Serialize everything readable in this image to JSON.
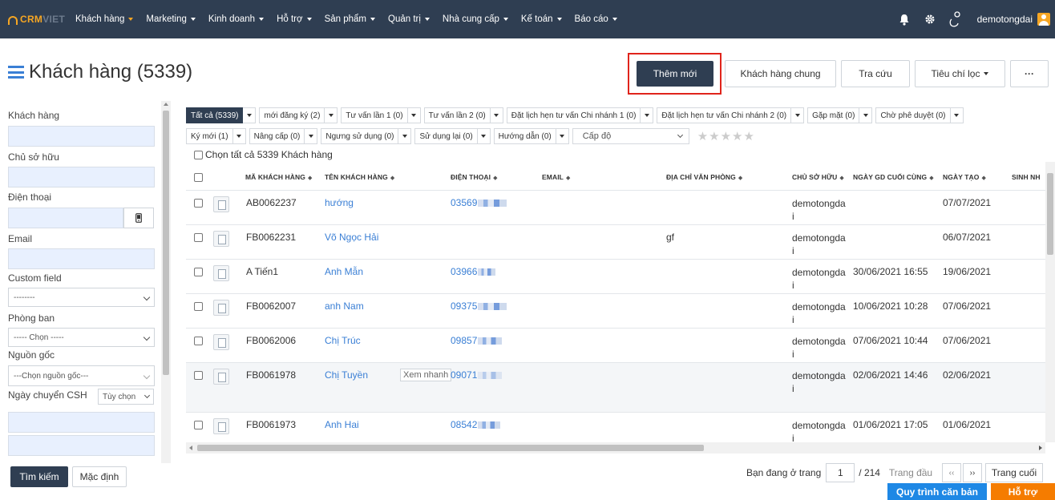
{
  "nav": {
    "logo_crm": "CRM",
    "logo_viet": "VIET",
    "menu": [
      {
        "label": "Khách hàng",
        "active": true
      },
      {
        "label": "Marketing"
      },
      {
        "label": "Kinh doanh"
      },
      {
        "label": "Hỗ trợ"
      },
      {
        "label": "Sản phẩm"
      },
      {
        "label": "Quản trị"
      },
      {
        "label": "Nhà cung cấp"
      },
      {
        "label": "Kế toán"
      },
      {
        "label": "Báo cáo"
      }
    ],
    "user_name": "demotongdai",
    "icons": [
      "bell-icon",
      "gear-icon",
      "location-pin-icon",
      "user-avatar-icon"
    ]
  },
  "header": {
    "title": "Khách hàng (5339)",
    "add_new": "Thêm mới",
    "shared_customers": "Khách hàng chung",
    "lookup": "Tra cứu",
    "filter_criteria": "Tiêu chí lọc",
    "more": "···"
  },
  "sidebar": {
    "customer_label": "Khách hàng",
    "owner_label": "Chủ sở hữu",
    "phone_label": "Điện thoại",
    "email_label": "Email",
    "custom_field_label": "Custom field",
    "custom_field_value": "--------",
    "department_label": "Phòng ban",
    "department_value": "----- Chọn -----",
    "source_label": "Nguồn gốc",
    "source_value": "---Chọn nguồn gốc---",
    "transfer_date_label": "Ngày chuyển CSH",
    "transfer_date_option": "Tùy chọn",
    "search_button": "Tìm kiếm",
    "default_button": "Mặc định"
  },
  "tags_row1": [
    {
      "label": "Tất cả (5339)",
      "active": true
    },
    {
      "label": "mới đăng ký (2)"
    },
    {
      "label": "Tư vấn lần 1 (0)"
    },
    {
      "label": "Tư vấn lần 2 (0)"
    },
    {
      "label": "Đặt lịch hẹn tư vấn Chi nhánh 1 (0)"
    },
    {
      "label": "Đặt lịch hẹn tư vấn Chi nhánh 2 (0)"
    },
    {
      "label": "Gặp mặt (0)"
    },
    {
      "label": "Chờ phê duyệt (0)"
    }
  ],
  "tags_row2": [
    {
      "label": "Ký mới (1)"
    },
    {
      "label": "Nâng cấp (0)"
    },
    {
      "label": "Ngưng sử dụng (0)"
    },
    {
      "label": "Sử dụng lại (0)"
    },
    {
      "label": "Hướng dẫn (0)"
    }
  ],
  "level_select": "Cấp độ",
  "stars": "★★★★★",
  "select_all": "Chọn tất cả 5339 Khách hàng",
  "table": {
    "columns": [
      "MÃ KHÁCH HÀNG",
      "TÊN KHÁCH HÀNG",
      "ĐIỆN THOẠI",
      "EMAIL",
      "ĐỊA CHỈ VĂN PHÒNG",
      "CHỦ SỞ HỮU",
      "NGÀY GD CUỐI CÙNG",
      "NGÀY TẠO",
      "SINH NH"
    ],
    "rows": [
      {
        "code": "AB0062237",
        "name": "hướng",
        "phone": "03569",
        "email": "",
        "address": "",
        "owner": "demotongda",
        "owner2": "i",
        "last_tx": "",
        "created": "07/07/2021"
      },
      {
        "code": "FB0062231",
        "name": "Võ Ngọc Hải",
        "phone": "",
        "email": "",
        "address": "gf",
        "owner": "demotongda",
        "owner2": "i",
        "last_tx": "",
        "created": "06/07/2021"
      },
      {
        "code": "A Tiến1",
        "name": "Anh Mẫn",
        "phone": "03966",
        "email": "",
        "address": "",
        "owner": "demotongda",
        "owner2": "i",
        "last_tx": "30/06/2021 16:55",
        "created": "19/06/2021"
      },
      {
        "code": "FB0062007",
        "name": "anh Nam",
        "phone": "09375",
        "email": "",
        "address": "",
        "owner": "demotongda",
        "owner2": "i",
        "last_tx": "10/06/2021 10:28",
        "created": "07/06/2021"
      },
      {
        "code": "FB0062006",
        "name": "Chị Trúc",
        "phone": "09857",
        "email": "",
        "address": "",
        "owner": "demotongda",
        "owner2": "i",
        "last_tx": "07/06/2021 10:44",
        "created": "07/06/2021"
      },
      {
        "code": "FB0061978",
        "name": "Chị Tuyền",
        "phone": "09071",
        "email": "",
        "address": "",
        "owner": "demotongda",
        "owner2": "i",
        "last_tx": "02/06/2021 14:46",
        "created": "02/06/2021",
        "quick_view": "Xem nhanh"
      },
      {
        "code": "FB0061973",
        "name": "Anh Hai",
        "phone": "08542",
        "email": "",
        "address": "",
        "owner": "demotongda",
        "owner2": "i",
        "last_tx": "01/06/2021 17:05",
        "created": "01/06/2021"
      }
    ]
  },
  "pagination": {
    "label": "Bạn đang ở trang",
    "current": "1",
    "total": "/ 214",
    "first": "Trang đầu",
    "prev": "‹‹",
    "next": "››",
    "last": "Trang cuối"
  },
  "footer": {
    "workflow": "Quy trình căn bản",
    "help": "Hỗ trợ"
  },
  "colors": {
    "navbar": "#2f3e52",
    "brand_orange": "#f6a623",
    "link_blue": "#3a7fd5",
    "highlight_red": "#e0241b"
  }
}
